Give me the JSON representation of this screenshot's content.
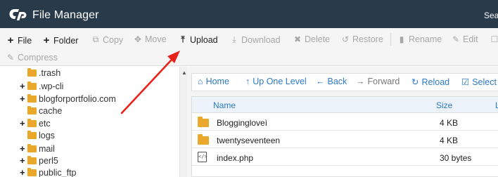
{
  "header": {
    "title": "File Manager",
    "search_partial": "Sea"
  },
  "toolbar": {
    "items": [
      {
        "label": "File",
        "icon": "plus-icon",
        "glyph": "+",
        "enabled": true
      },
      {
        "label": "Folder",
        "icon": "plus-icon",
        "glyph": "+",
        "enabled": true
      },
      {
        "label": "Copy",
        "icon": "copy-icon",
        "glyph": "⧉",
        "enabled": false
      },
      {
        "label": "Move",
        "icon": "move-icon",
        "glyph": "✥",
        "enabled": false
      },
      {
        "label": "Upload",
        "icon": "upload-icon",
        "glyph": "⤒",
        "enabled": true
      },
      {
        "label": "Download",
        "icon": "download-icon",
        "glyph": "⤓",
        "enabled": false
      },
      {
        "label": "Delete",
        "icon": "delete-icon",
        "glyph": "✖",
        "enabled": false
      },
      {
        "label": "Restore",
        "icon": "restore-icon",
        "glyph": "↺",
        "enabled": false
      },
      {
        "label": "Rename",
        "icon": "rename-icon",
        "glyph": "▮",
        "enabled": false
      },
      {
        "label": "Edit",
        "icon": "pencil-icon",
        "glyph": "✎",
        "enabled": false
      },
      {
        "label": "Compress",
        "icon": "compress-icon",
        "glyph": "✎",
        "enabled": false
      }
    ]
  },
  "tree": {
    "items": [
      {
        "label": ".trash",
        "expandable": false
      },
      {
        "label": ".wp-cli",
        "expandable": true
      },
      {
        "label": "blogforportfolio.com",
        "expandable": true
      },
      {
        "label": "cache",
        "expandable": false
      },
      {
        "label": "etc",
        "expandable": true
      },
      {
        "label": "logs",
        "expandable": false
      },
      {
        "label": "mail",
        "expandable": true
      },
      {
        "label": "perl5",
        "expandable": true
      },
      {
        "label": "public_ftp",
        "expandable": true
      }
    ]
  },
  "nav": {
    "home": "Home",
    "up": "Up One Level",
    "back": "Back",
    "forward": "Forward",
    "reload": "Reload",
    "select_all": "Select A"
  },
  "table": {
    "headers": {
      "name": "Name",
      "size": "Size",
      "last": "L"
    },
    "rows": [
      {
        "name": "Bloggingloveì",
        "size": "4 KB",
        "type": "folder"
      },
      {
        "name": "twentyseventeen",
        "size": "4 KB",
        "type": "folder"
      },
      {
        "name": "index.php",
        "size": "30 bytes",
        "type": "file"
      }
    ]
  },
  "colors": {
    "header_bg": "#293a4a",
    "link": "#2d79c7",
    "folder": "#eaa92b",
    "annotation_arrow": "#e8221b"
  }
}
